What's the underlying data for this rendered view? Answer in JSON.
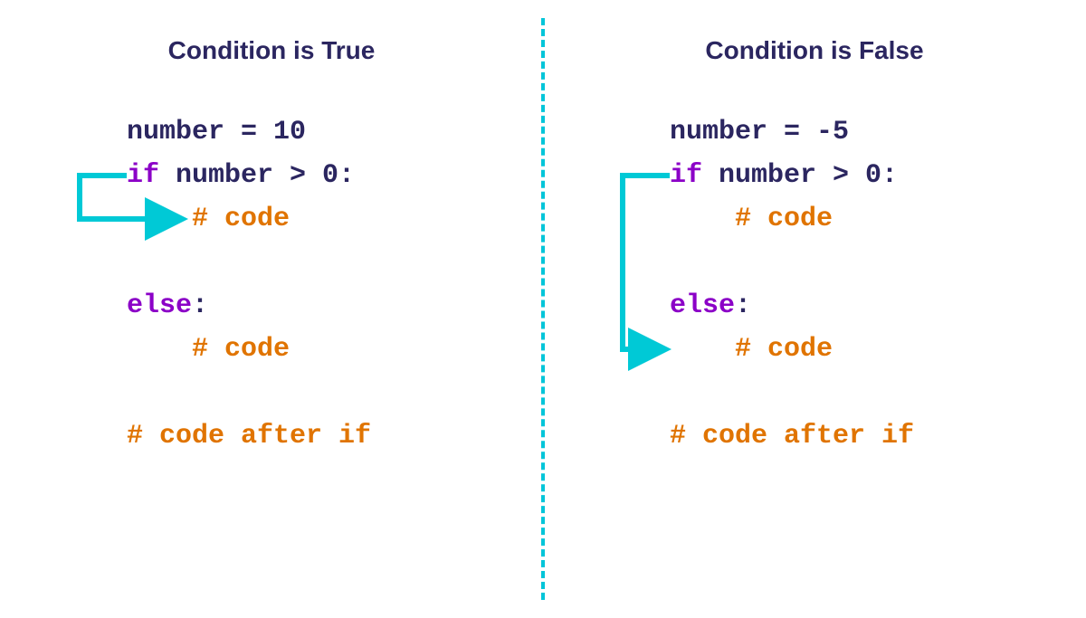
{
  "left": {
    "heading": "Condition is True",
    "line1a": "number = 10",
    "line2a": "if",
    "line2b": " number > 0:",
    "line3a": "    # code",
    "line4a": "else",
    "line4b": ":",
    "line5a": "    # code",
    "line6a": "# code after if"
  },
  "right": {
    "heading": "Condition is False",
    "line1a": "number = -5",
    "line2a": "if",
    "line2b": " number > 0:",
    "line3a": "    # code",
    "line4a": "else",
    "line4b": ":",
    "line5a": "    # code",
    "line6a": "# code after if"
  },
  "colors": {
    "arrow": "#00c9d6",
    "keyword": "#8b00c7",
    "comment": "#e07400",
    "text": "#2b2660"
  }
}
